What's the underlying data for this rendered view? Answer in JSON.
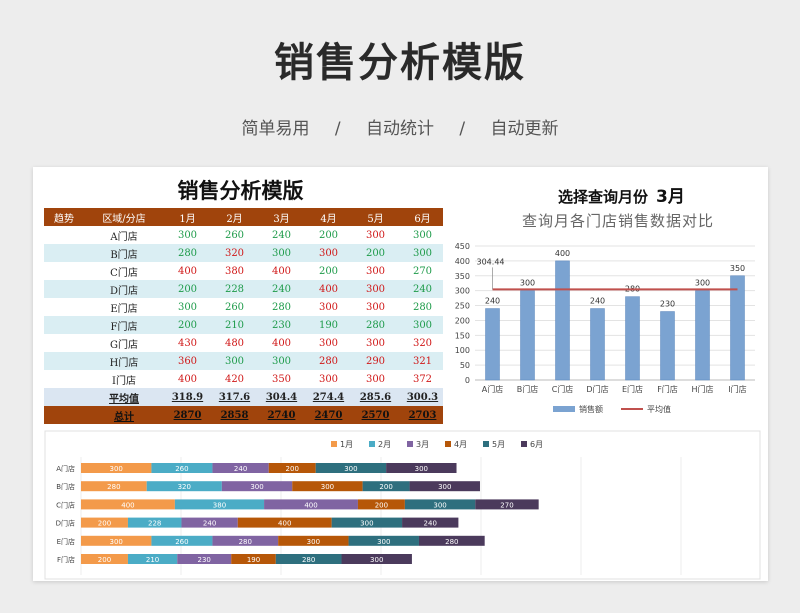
{
  "hero": {
    "title": "销售分析模版",
    "subtitle": [
      "简单易用",
      "/",
      "自动统计",
      "/",
      "自动更新"
    ]
  },
  "sheet": {
    "title": "销售分析模版",
    "month_select_label": "选择查询月份",
    "month_select_value": "3月",
    "headers": [
      "趋势",
      "区域/分店",
      "1月",
      "2月",
      "3月",
      "4月",
      "5月",
      "6月"
    ],
    "rows": [
      {
        "store": "A门店",
        "values": [
          "300",
          "260",
          "240",
          "200",
          "300",
          "300"
        ],
        "colors": [
          "g",
          "g",
          "g",
          "g",
          "r",
          "g"
        ]
      },
      {
        "store": "B门店",
        "values": [
          "280",
          "320",
          "300",
          "300",
          "200",
          "300"
        ],
        "colors": [
          "g",
          "r",
          "g",
          "r",
          "g",
          "g"
        ]
      },
      {
        "store": "C门店",
        "values": [
          "400",
          "380",
          "400",
          "200",
          "300",
          "270"
        ],
        "colors": [
          "r",
          "r",
          "r",
          "g",
          "r",
          "g"
        ]
      },
      {
        "store": "D门店",
        "values": [
          "200",
          "228",
          "240",
          "400",
          "300",
          "240"
        ],
        "colors": [
          "g",
          "g",
          "g",
          "r",
          "r",
          "g"
        ]
      },
      {
        "store": "E门店",
        "values": [
          "300",
          "260",
          "280",
          "300",
          "300",
          "280"
        ],
        "colors": [
          "g",
          "g",
          "g",
          "r",
          "r",
          "g"
        ]
      },
      {
        "store": "F门店",
        "values": [
          "200",
          "210",
          "230",
          "190",
          "280",
          "300"
        ],
        "colors": [
          "g",
          "g",
          "g",
          "g",
          "g",
          "g"
        ]
      },
      {
        "store": "G门店",
        "values": [
          "430",
          "480",
          "400",
          "300",
          "300",
          "320"
        ],
        "colors": [
          "r",
          "r",
          "r",
          "r",
          "r",
          "r"
        ]
      },
      {
        "store": "H门店",
        "values": [
          "360",
          "300",
          "300",
          "280",
          "290",
          "321"
        ],
        "colors": [
          "r",
          "g",
          "g",
          "r",
          "r",
          "r"
        ]
      },
      {
        "store": "I门店",
        "values": [
          "400",
          "420",
          "350",
          "300",
          "300",
          "372"
        ],
        "colors": [
          "r",
          "r",
          "r",
          "r",
          "r",
          "r"
        ]
      }
    ],
    "avg_label": "平均值",
    "avg_values": [
      "318.9",
      "317.6",
      "304.4",
      "274.4",
      "285.6",
      "300.3"
    ],
    "total_label": "总计",
    "total_values": [
      "2870",
      "2858",
      "2740",
      "2470",
      "2570",
      "2703"
    ]
  },
  "chart_data": [
    {
      "type": "bar",
      "title": "查询月各门店销售数据对比",
      "categories": [
        "A门店",
        "B门店",
        "C门店",
        "D门店",
        "E门店",
        "F门店",
        "H门店",
        "I门店"
      ],
      "series": [
        {
          "name": "销售额",
          "values": [
            240,
            300,
            400,
            240,
            280,
            230,
            300,
            350
          ],
          "color": "#7ba3d1"
        },
        {
          "name": "平均值",
          "type": "line",
          "value": 304.44,
          "color": "#c0504d"
        }
      ],
      "average_label": "304.44",
      "ylim": [
        0,
        450
      ],
      "yticks": [
        0,
        50,
        100,
        150,
        200,
        250,
        300,
        350,
        400,
        450
      ],
      "grid": true,
      "legend": "bottom"
    },
    {
      "type": "bar",
      "orientation": "horizontal",
      "stacked": true,
      "categories": [
        "A门店",
        "B门店",
        "C门店",
        "D门店",
        "E门店",
        "F门店"
      ],
      "series": [
        {
          "name": "1月",
          "values": [
            300,
            280,
            400,
            200,
            300,
            200
          ],
          "color": "#f39a4a"
        },
        {
          "name": "2月",
          "values": [
            260,
            320,
            380,
            228,
            260,
            210
          ],
          "color": "#4bacc6"
        },
        {
          "name": "3月",
          "values": [
            240,
            300,
            400,
            240,
            280,
            230
          ],
          "color": "#8064a2"
        },
        {
          "name": "4月",
          "values": [
            200,
            300,
            200,
            400,
            300,
            190
          ],
          "color": "#b65708"
        },
        {
          "name": "5月",
          "values": [
            300,
            200,
            300,
            300,
            300,
            280
          ],
          "color": "#2e6f7e"
        },
        {
          "name": "6月",
          "values": [
            300,
            300,
            270,
            240,
            280,
            300
          ],
          "color": "#4b3a5c"
        }
      ],
      "legend": "top",
      "grid": true
    }
  ]
}
